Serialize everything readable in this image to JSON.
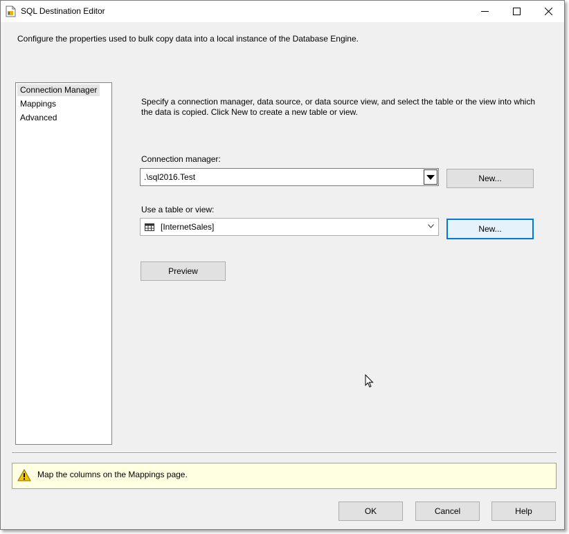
{
  "window": {
    "title": "SQL Destination Editor",
    "minimize_glyph": "—",
    "maximize_glyph": "☐",
    "close_glyph": "✕"
  },
  "header": {
    "description": "Configure the properties used to bulk copy data into a local instance of the Database Engine."
  },
  "nav": {
    "items": [
      {
        "label": "Connection Manager",
        "selected": true
      },
      {
        "label": "Mappings",
        "selected": false
      },
      {
        "label": "Advanced",
        "selected": false
      }
    ]
  },
  "main": {
    "instructions": "Specify a connection manager, data source, or data source view, and select the table or the view into which the data is copied. Click New to create a new table or view.",
    "connection_manager": {
      "label": "Connection manager:",
      "value": ".\\sql2016.Test",
      "new_button": "New..."
    },
    "table_or_view": {
      "label": "Use a table or view:",
      "value": "[InternetSales]",
      "icon": "table-grid-icon",
      "new_button": "New..."
    },
    "preview_button": "Preview"
  },
  "message": {
    "icon": "warning-icon",
    "text": "Map the columns on the Mappings page."
  },
  "footer": {
    "ok": "OK",
    "cancel": "Cancel",
    "help": "Help"
  },
  "colors": {
    "focus_border": "#0078d7",
    "message_bg": "#ffffe1",
    "warning": "#f5c400"
  }
}
